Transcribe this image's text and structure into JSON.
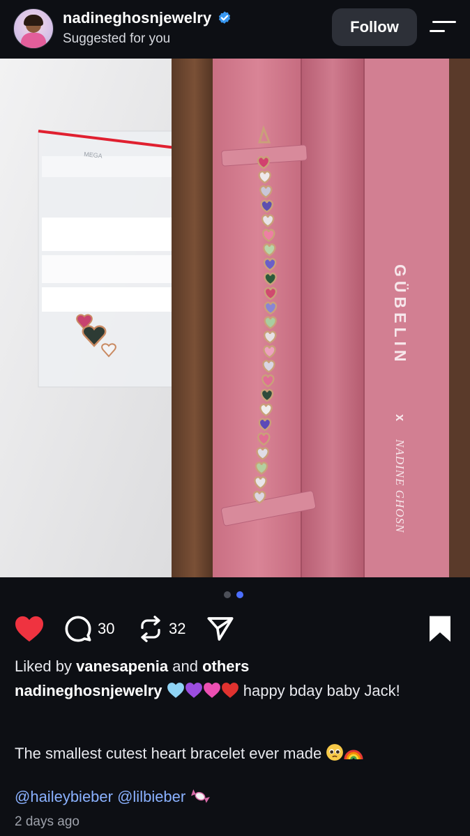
{
  "header": {
    "username": "nadineghosnjewelry",
    "subtitle": "Suggested for you",
    "follow_label": "Follow"
  },
  "post": {
    "carousel_pages": 2,
    "carousel_active_page": 2,
    "box_brand": "GÜBELIN",
    "box_cross": "x",
    "box_partner": "NADINE GHOSN",
    "bag_print": "MEGA"
  },
  "actions": {
    "comments_count": "30",
    "reposts_count": "32"
  },
  "caption": {
    "liked_prefix": "Liked by ",
    "liked_user": "vanesapenia",
    "liked_and": " and ",
    "liked_others": "others",
    "author": "nadineghosnjewelry",
    "text_part1": " happy bday baby Jack!",
    "text_part2": "The smallest cutest heart bracelet ever made",
    "mentions": "@haileybieber @lilbieber",
    "time": "2 days ago"
  },
  "icons": {
    "verified": "verified-badge-icon",
    "menu": "menu-icon",
    "like": "heart-icon",
    "comment": "comment-icon",
    "repost": "repost-icon",
    "share": "send-icon",
    "bookmark": "bookmark-icon"
  },
  "colors": {
    "background": "#0d0f14",
    "like_red": "#ef3340",
    "link_blue": "#8ab1ff",
    "verified_blue": "#3897f0",
    "active_dot": "#4c6fff"
  }
}
